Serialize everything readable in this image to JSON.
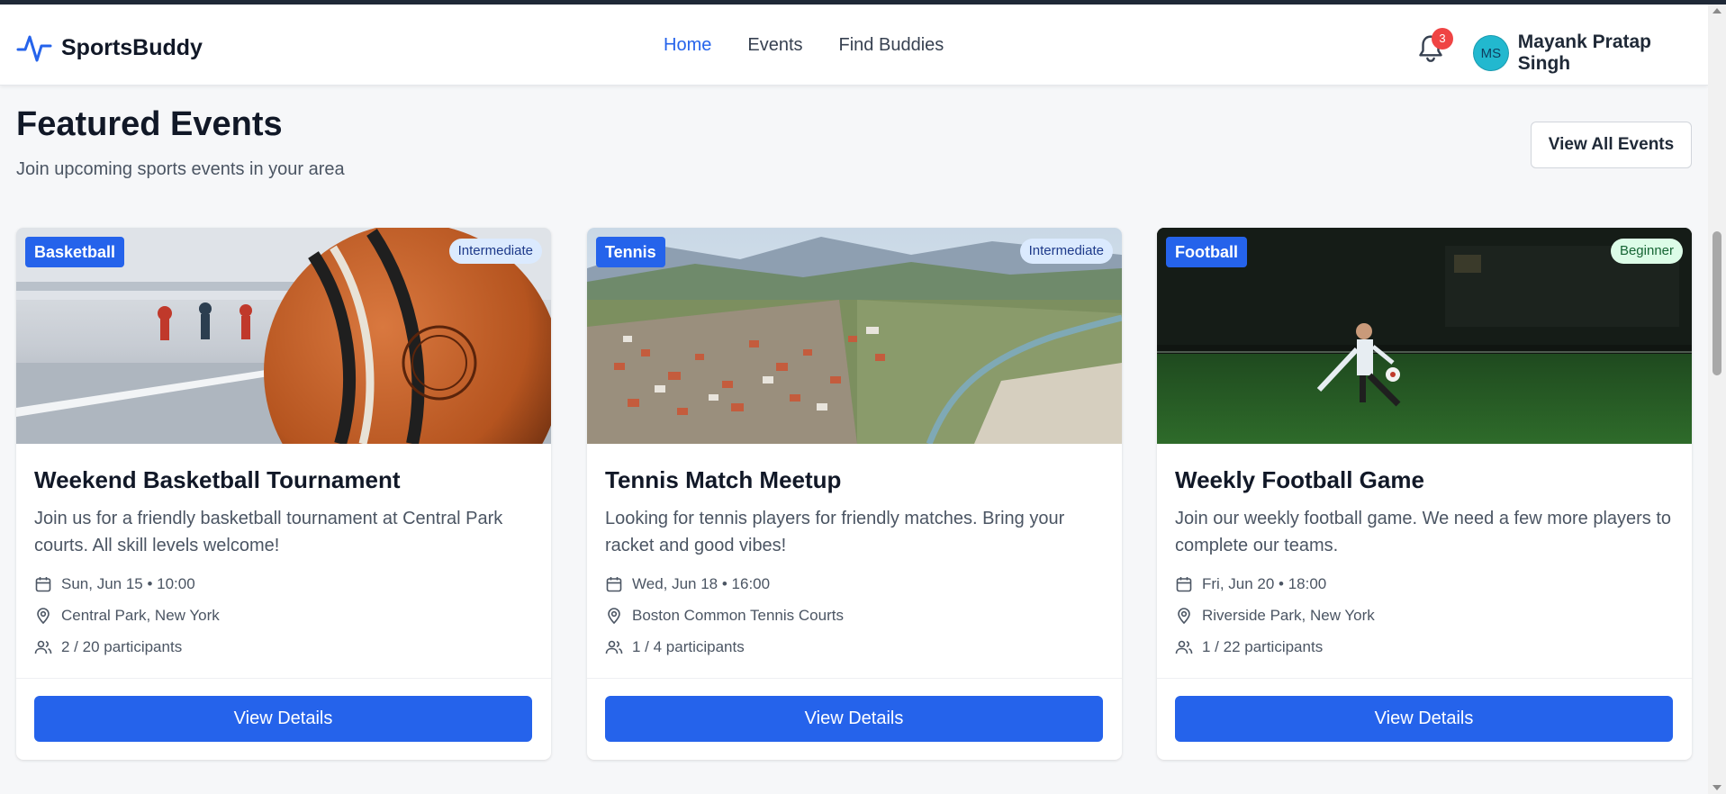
{
  "brand": {
    "name": "SportsBuddy",
    "logo_icon": "activity-pulse-icon",
    "accent": "#2563eb"
  },
  "nav": {
    "links": [
      {
        "label": "Home",
        "active": true
      },
      {
        "label": "Events",
        "active": false
      },
      {
        "label": "Find Buddies",
        "active": false
      }
    ]
  },
  "notifications": {
    "icon": "bell-icon",
    "count": "3",
    "badge_color": "#ef4444"
  },
  "user": {
    "initials": "MS",
    "name": "Mayank Pratap Singh",
    "avatar_color": "#22b8cf"
  },
  "section": {
    "title": "Featured Events",
    "subtitle": "Join upcoming sports events in your area",
    "view_all_label": "View All Events"
  },
  "events": [
    {
      "sport": "Basketball",
      "level": "Intermediate",
      "image": "basketball-photo",
      "title": "Weekend Basketball Tournament",
      "description": "Join us for a friendly basketball tournament at Central Park courts. All skill levels welcome!",
      "datetime": "Sun, Jun 15 • 10:00",
      "location": "Central Park, New York",
      "participants": "2 / 20 participants",
      "button_label": "View Details"
    },
    {
      "sport": "Tennis",
      "level": "Intermediate",
      "image": "town-valley-photo",
      "title": "Tennis Match Meetup",
      "description": "Looking for tennis players for friendly matches. Bring your racket and good vibes!",
      "datetime": "Wed, Jun 18 • 16:00",
      "location": "Boston Common Tennis Courts",
      "participants": "1 / 4 participants",
      "button_label": "View Details"
    },
    {
      "sport": "Football",
      "level": "Beginner",
      "image": "football-player-photo",
      "title": "Weekly Football Game",
      "description": "Join our weekly football game. We need a few more players to complete our teams.",
      "datetime": "Fri, Jun 20 • 18:00",
      "location": "Riverside Park, New York",
      "participants": "1 / 22 participants",
      "button_label": "View Details"
    }
  ]
}
